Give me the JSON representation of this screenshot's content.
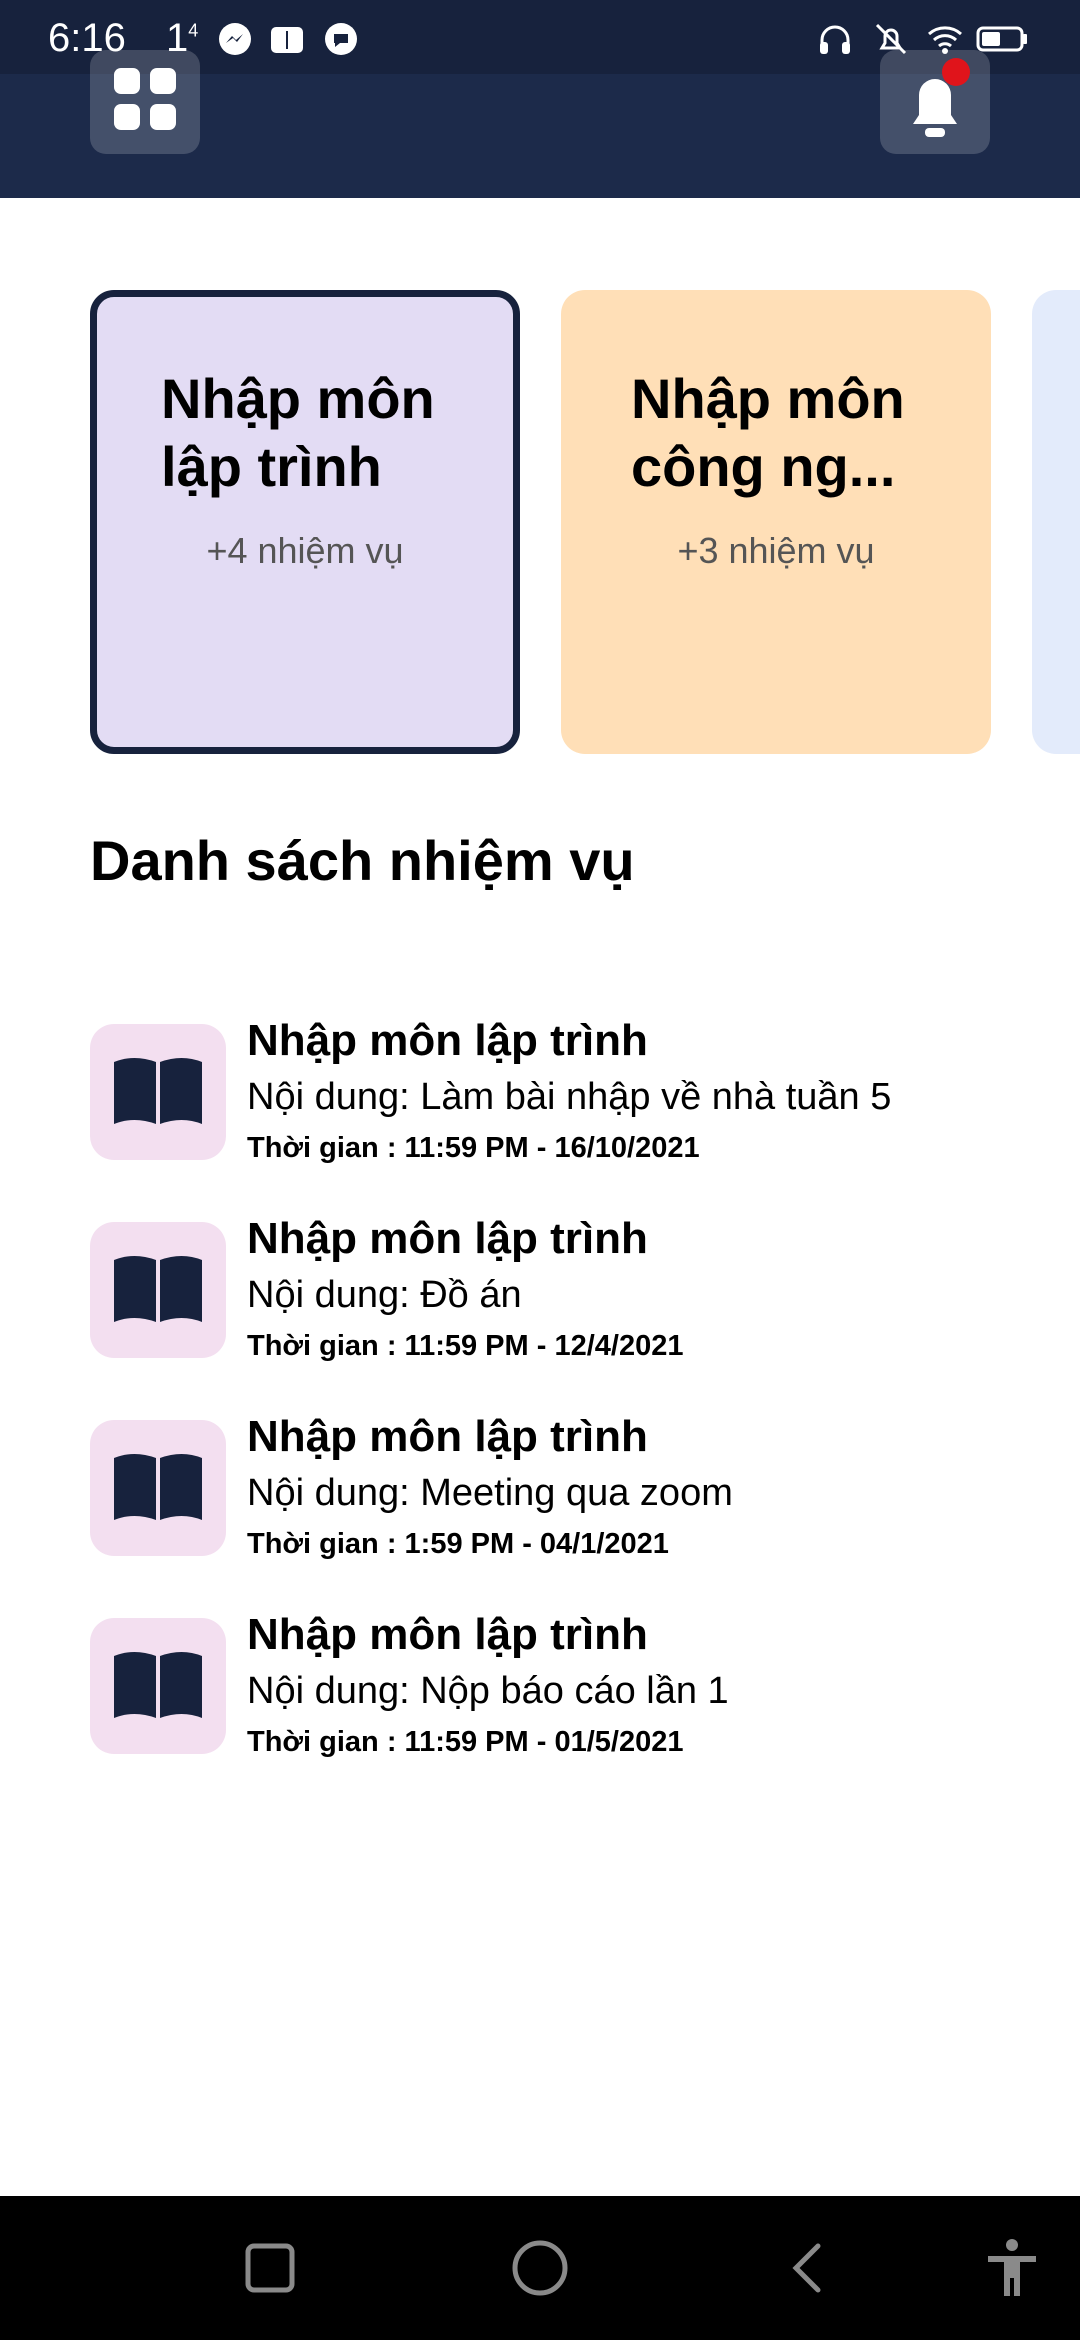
{
  "status_bar": {
    "time": "6:16",
    "extra": "1",
    "extra_sup": "4",
    "icons": [
      "messenger-icon",
      "book-app-icon",
      "chat-app-icon",
      "headphones-icon",
      "bell-off-icon",
      "wifi-icon",
      "battery-icon"
    ]
  },
  "header": {
    "menu_icon": "grid-menu-icon",
    "notification_icon": "bell-icon"
  },
  "subjects": [
    {
      "title": "Nhập môn lập trình",
      "count": "+4 nhiệm vụ",
      "color": "#e3dcf4"
    },
    {
      "title": "Nhập môn công ng...",
      "count": "+3 nhiệm vụ",
      "color": "#ffdfb7"
    },
    {
      "title": "",
      "count": "",
      "color": "#e3ebfb"
    }
  ],
  "section_title": "Danh sách nhiệm vụ",
  "tasks": [
    {
      "title": "Nhập môn lập trình",
      "content": "Nội dung: Làm bài nhập về nhà tuần 5",
      "time": "Thời gian : 11:59 PM - 16/10/2021"
    },
    {
      "title": "Nhập môn lập trình",
      "content": "Nội dung: Đồ án",
      "time": "Thời gian : 11:59 PM - 12/4/2021"
    },
    {
      "title": "Nhập môn lập trình",
      "content": "Nội dung: Meeting qua zoom",
      "time": "Thời gian : 1:59 PM - 04/1/2021"
    },
    {
      "title": "Nhập môn lập trình",
      "content": "Nội dung: Nộp báo cáo lần 1",
      "time": "Thời gian : 11:59 PM - 01/5/2021"
    }
  ],
  "nav_bar": [
    "recents-icon",
    "home-icon",
    "back-icon",
    "accessibility-icon"
  ],
  "colors": {
    "header": "#1c2a4a",
    "accent_dark": "#17223d",
    "task_icon_bg": "#f3dff0",
    "notification_dot": "#e0141b"
  }
}
